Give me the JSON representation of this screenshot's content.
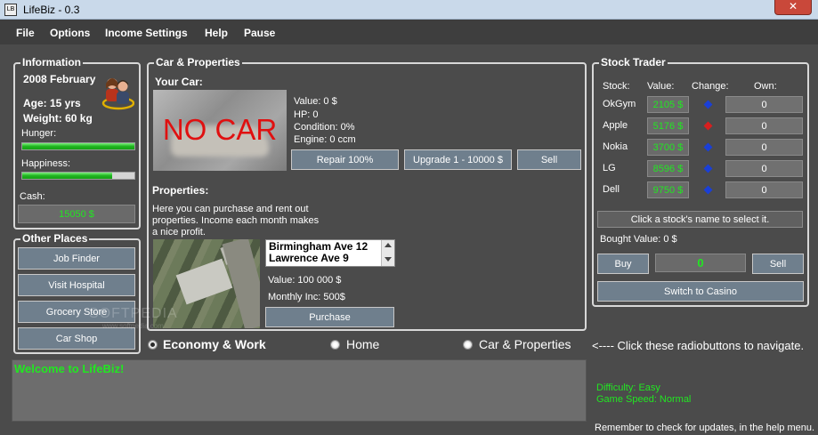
{
  "window": {
    "title": "LifeBiz - 0.3",
    "icon_text": "LB",
    "close": "✕"
  },
  "menu": [
    "File",
    "Options",
    "Income Settings",
    "Help",
    "Pause"
  ],
  "information": {
    "title": "Information",
    "date": "2008 February",
    "age": "Age: 15 yrs",
    "weight": "Weight: 60 kg",
    "hunger_label": "Hunger:",
    "hunger_level": 1.0,
    "happiness_label": "Happiness:",
    "happiness_level": 0.8,
    "cash_label": "Cash:",
    "cash_value": "15050 $"
  },
  "other_places": {
    "title": "Other Places",
    "buttons": [
      "Job Finder",
      "Visit Hospital",
      "Grocery Store",
      "Car Shop"
    ]
  },
  "car_properties": {
    "title": "Car & Properties",
    "your_car_label": "Your Car:",
    "car_image_text": "NO CAR",
    "car_value": "Value: 0 $",
    "car_hp": "HP: 0",
    "car_condition": "Condition: 0%",
    "car_engine": "Engine: 0 ccm",
    "repair_button": "Repair 100%",
    "upgrade_button": "Upgrade 1 - 10000 $",
    "sell_button": "Sell",
    "properties_label": "Properties:",
    "properties_desc": "Here you can purchase and rent out properties. Income each month makes a nice profit.",
    "property_list": [
      "Birmingham Ave 12",
      "Lawrence Ave 9"
    ],
    "property_value": "Value: 100 000 $",
    "monthly_inc": "Monthly Inc: 500$",
    "purchase_button": "Purchase"
  },
  "stock_trader": {
    "title": "Stock Trader",
    "headers": {
      "stock": "Stock:",
      "value": "Value:",
      "change": "Change:",
      "own": "Own:"
    },
    "stocks": [
      {
        "name": "OkGym",
        "value": "2105 $",
        "change": "up",
        "own": "0"
      },
      {
        "name": "Apple",
        "value": "5176 $",
        "change": "down",
        "own": "0"
      },
      {
        "name": "Nokia",
        "value": "3700 $",
        "change": "up",
        "own": "0"
      },
      {
        "name": "LG",
        "value": "8596 $",
        "change": "up",
        "own": "0"
      },
      {
        "name": "Dell",
        "value": "9750 $",
        "change": "up",
        "own": "0"
      }
    ],
    "hint": "Click a stock's name to select it.",
    "bought_value": "Bought Value: 0 $",
    "buy_button": "Buy",
    "amount": "0",
    "sell_button": "Sell",
    "casino_button": "Switch to Casino"
  },
  "navigation": {
    "options": [
      "Economy & Work",
      "Home",
      "Car & Properties"
    ],
    "selected": "Economy & Work",
    "hint": "<---- Click these radiobuttons to navigate."
  },
  "log": {
    "text": "Welcome to LifeBiz!"
  },
  "status": {
    "difficulty": "Difficulty: Easy",
    "game_speed": "Game Speed: Normal",
    "reminder": "Remember to check for updates, in the help menu."
  },
  "watermark": {
    "text": "SOFTPEDIA",
    "subtext": "www.softpedia.com"
  },
  "colors": {
    "green_text": "#22e622",
    "background": "#4b4b4b",
    "button": "#6f7f8d",
    "up": "#1a3fd6",
    "down": "#d81e1e"
  }
}
